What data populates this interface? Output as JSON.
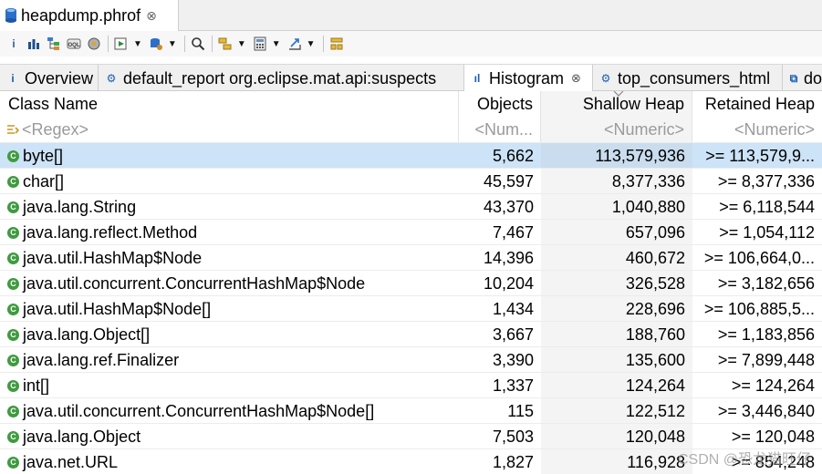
{
  "editor_tab": {
    "title": "heapdump.phrof",
    "close": "⊗"
  },
  "toolbar": {
    "info": "i",
    "drop": "▼"
  },
  "subtabs": [
    {
      "label": "Overview",
      "icon": "i"
    },
    {
      "label": "default_report  org.eclipse.mat.api:suspects",
      "icon": "⚙"
    },
    {
      "label": "Histogram",
      "icon": "ıl",
      "close": "⊗"
    },
    {
      "label": "top_consumers_html",
      "icon": "⚙"
    },
    {
      "label": "do",
      "icon": "⧉"
    }
  ],
  "table": {
    "columns": [
      "Class Name",
      "Objects",
      "Shallow Heap",
      "Retained Heap"
    ],
    "filters": [
      "<Regex>",
      "<Num...",
      "<Numeric>",
      "<Numeric>"
    ],
    "rows": [
      [
        "byte[]",
        "5,662",
        "113,579,936",
        ">= 113,579,9..."
      ],
      [
        "char[]",
        "45,597",
        "8,377,336",
        ">= 8,377,336"
      ],
      [
        "java.lang.String",
        "43,370",
        "1,040,880",
        ">= 6,118,544"
      ],
      [
        "java.lang.reflect.Method",
        "7,467",
        "657,096",
        ">= 1,054,112"
      ],
      [
        "java.util.HashMap$Node",
        "14,396",
        "460,672",
        ">= 106,664,0..."
      ],
      [
        "java.util.concurrent.ConcurrentHashMap$Node",
        "10,204",
        "326,528",
        ">= 3,182,656"
      ],
      [
        "java.util.HashMap$Node[]",
        "1,434",
        "228,696",
        ">= 106,885,5..."
      ],
      [
        "java.lang.Object[]",
        "3,667",
        "188,760",
        ">= 1,183,856"
      ],
      [
        "java.lang.ref.Finalizer",
        "3,390",
        "135,600",
        ">= 7,899,448"
      ],
      [
        "int[]",
        "1,337",
        "124,264",
        ">= 124,264"
      ],
      [
        "java.util.concurrent.ConcurrentHashMap$Node[]",
        "115",
        "122,512",
        ">= 3,446,840"
      ],
      [
        "java.lang.Object",
        "7,503",
        "120,048",
        ">= 120,048"
      ],
      [
        "java.net.URL",
        "1,827",
        "116,928",
        ">= 854,248"
      ]
    ]
  },
  "watermark": "CSDN @恐龙猫旺仔"
}
